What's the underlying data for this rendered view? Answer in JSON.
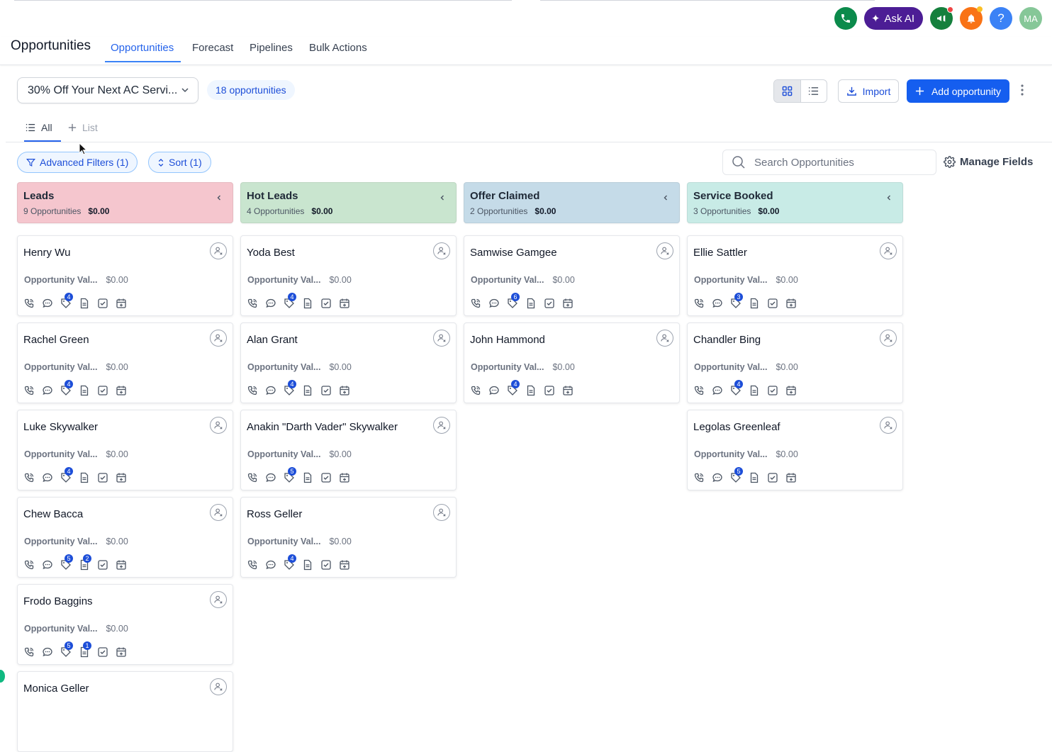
{
  "top": {
    "ask_ai_label": "Ask AI",
    "avatar_initials": "MA",
    "help_label": "?"
  },
  "header": {
    "title": "Opportunities",
    "tabs": [
      "Opportunities",
      "Forecast",
      "Pipelines",
      "Bulk Actions"
    ]
  },
  "toolbar": {
    "pipeline": "30% Off Your Next AC Servi...",
    "count": "18 opportunities",
    "import_label": "Import",
    "add_label": "Add opportunity"
  },
  "lists": {
    "all_label": "All",
    "add_list_label": "List"
  },
  "filters": {
    "advanced": "Advanced Filters (1)",
    "sort": "Sort (1)",
    "search_placeholder": "Search Opportunities",
    "manage_fields": "Manage Fields"
  },
  "field_label": "Opportunity Val...",
  "columns": [
    {
      "title": "Leads",
      "sub": "9 Opportunities",
      "amount": "$0.00",
      "color": "#f5c6ce",
      "cards": [
        {
          "name": "Henry Wu",
          "value": "$0.00",
          "tag_count": "4",
          "note_count": ""
        },
        {
          "name": "Rachel Green",
          "value": "$0.00",
          "tag_count": "4",
          "note_count": ""
        },
        {
          "name": "Luke Skywalker",
          "value": "$0.00",
          "tag_count": "4",
          "note_count": ""
        },
        {
          "name": "Chew Bacca",
          "value": "$0.00",
          "tag_count": "5",
          "note_count": "2"
        },
        {
          "name": "Frodo Baggins",
          "value": "$0.00",
          "tag_count": "5",
          "note_count": "1"
        },
        {
          "name": "Monica Geller",
          "value": "",
          "tag_count": "",
          "note_count": ""
        }
      ]
    },
    {
      "title": "Hot Leads",
      "sub": "4 Opportunities",
      "amount": "$0.00",
      "color": "#c9e5cf",
      "cards": [
        {
          "name": "Yoda Best",
          "value": "$0.00",
          "tag_count": "4",
          "note_count": ""
        },
        {
          "name": "Alan Grant",
          "value": "$0.00",
          "tag_count": "4",
          "note_count": ""
        },
        {
          "name": "Anakin \"Darth Vader\" Skywalker",
          "value": "$0.00",
          "tag_count": "5",
          "note_count": ""
        },
        {
          "name": "Ross Geller",
          "value": "$0.00",
          "tag_count": "4",
          "note_count": ""
        }
      ]
    },
    {
      "title": "Offer Claimed",
      "sub": "2 Opportunities",
      "amount": "$0.00",
      "color": "#c5dbe8",
      "cards": [
        {
          "name": "Samwise Gamgee",
          "value": "$0.00",
          "tag_count": "6",
          "note_count": ""
        },
        {
          "name": "John Hammond",
          "value": "$0.00",
          "tag_count": "4",
          "note_count": ""
        }
      ]
    },
    {
      "title": "Service Booked",
      "sub": "3 Opportunities",
      "amount": "$0.00",
      "color": "#c8ebe6",
      "cards": [
        {
          "name": "Ellie Sattler",
          "value": "$0.00",
          "tag_count": "3",
          "note_count": ""
        },
        {
          "name": "Chandler Bing",
          "value": "$0.00",
          "tag_count": "4",
          "note_count": ""
        },
        {
          "name": "Legolas Greenleaf",
          "value": "$0.00",
          "tag_count": "5",
          "note_count": ""
        }
      ]
    }
  ]
}
